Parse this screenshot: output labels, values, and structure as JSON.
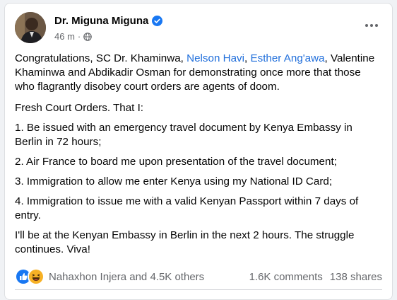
{
  "post": {
    "author": "Dr. Miguna Miguna",
    "time": "46 m",
    "separator": "·",
    "paragraphs": {
      "intro": {
        "before": "Congratulations, SC Dr. Khaminwa, ",
        "mention1": "Nelson Havi",
        "comma": ", ",
        "mention2": "Esther Ang'awa",
        "after": ", Valentine Khaminwa and Abdikadir Osman for demonstrating once more that those who flagrantly disobey court orders are agents of doom."
      },
      "p2": "Fresh Court Orders. That I:",
      "p3": "1. Be issued with an emergency travel document by Kenya Embassy in Berlin in 72 hours;",
      "p4": "2. Air France to board me upon presentation of the travel document;",
      "p5": "3. Immigration to allow me enter Kenya using my National ID Card;",
      "p6": "4. Immigration to issue me with a valid Kenyan Passport within 7 days of entry.",
      "p7": "I'll be at the Kenyan Embassy in Berlin in the next 2 hours. The struggle continues. Viva!"
    }
  },
  "reactions": {
    "icons": [
      "like-icon",
      "haha-icon"
    ],
    "summary": "Nahaxhon Injera and 4.5K others",
    "comments": "1.6K comments",
    "shares": "138 shares"
  },
  "colors": {
    "link": "#216fdb",
    "verified": "#1877f2",
    "like": "#1877f2",
    "haha": "#f7b125",
    "muted": "#65676b"
  }
}
